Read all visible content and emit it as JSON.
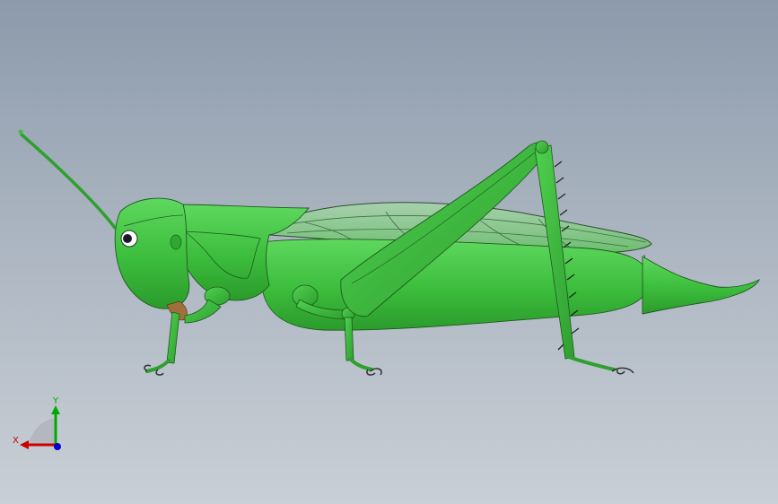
{
  "viewport": {
    "background_top": "#8c9aab",
    "background_bottom": "#c9cfd6"
  },
  "model": {
    "body_color": "#3fbf3f",
    "body_dark": "#2a9a2a",
    "body_light": "#62d862",
    "wing_color": "#7fc97f",
    "outline_color": "#1d5a1d"
  },
  "triad": {
    "x_label": "X",
    "y_label": "Y",
    "x_color": "#cc0000",
    "y_color": "#00aa00",
    "z_color": "#0000cc"
  }
}
